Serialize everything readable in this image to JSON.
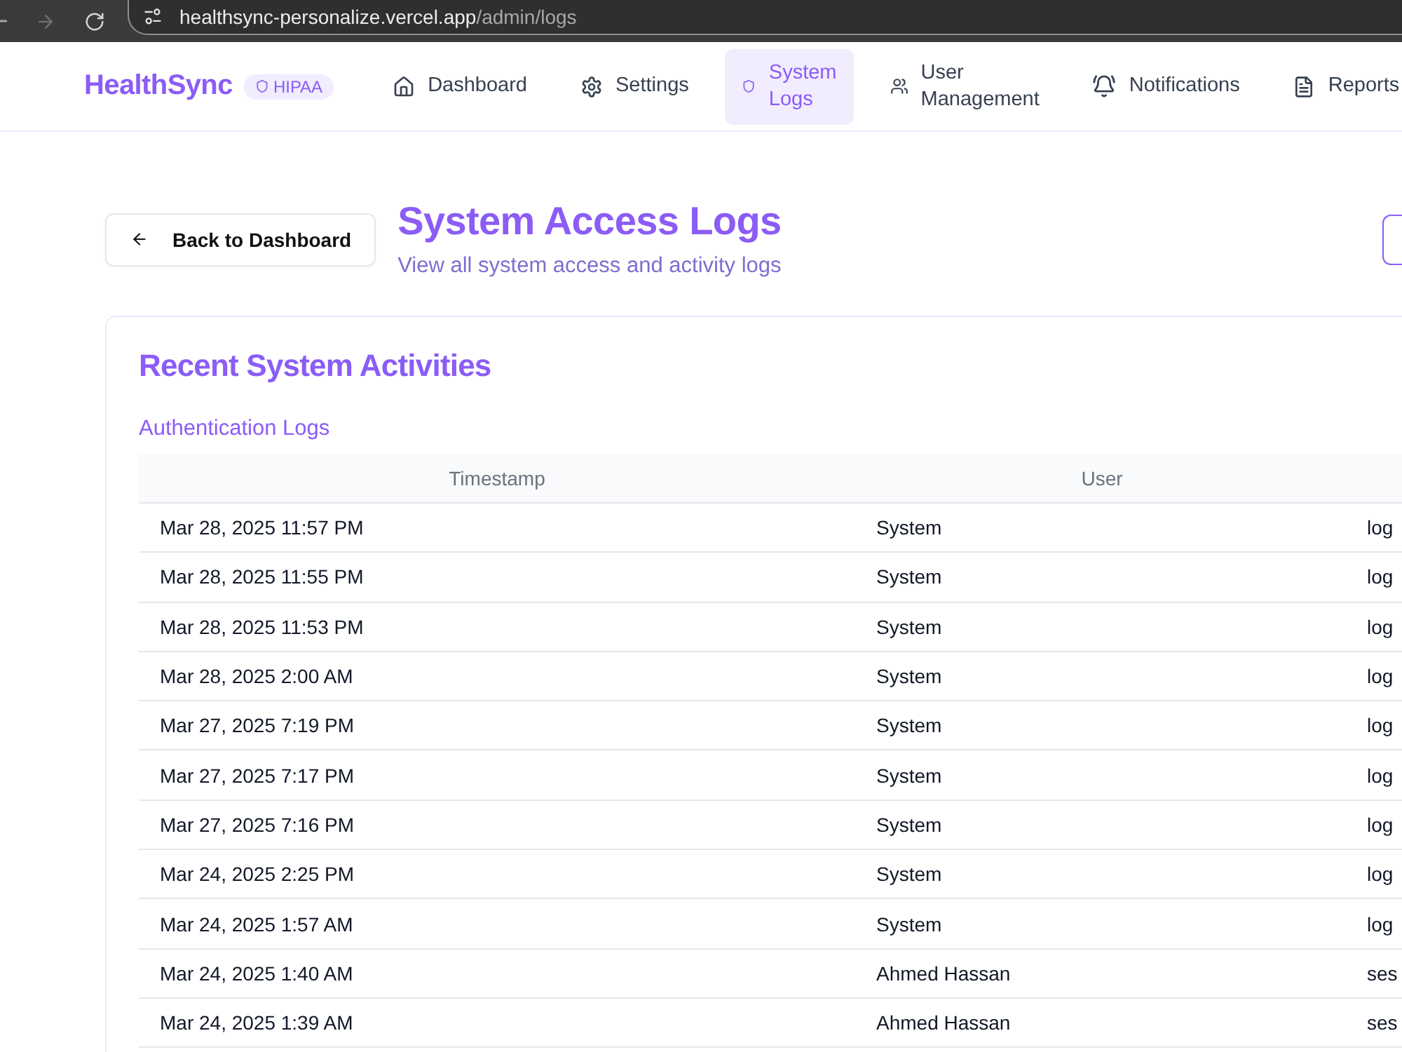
{
  "browser": {
    "url_host": "healthsync-personalize.vercel.app",
    "url_path": "/admin/logs"
  },
  "header": {
    "brand": "HealthSync",
    "badge": "HIPAA",
    "nav": [
      {
        "label": "Dashboard",
        "selected": false
      },
      {
        "label": "Settings",
        "selected": false
      },
      {
        "label": "System Logs",
        "selected": true
      },
      {
        "label": "User Management",
        "selected": false
      },
      {
        "label": "Notifications",
        "selected": false
      },
      {
        "label": "Reports",
        "selected": false
      }
    ]
  },
  "page": {
    "back_button": "Back to Dashboard",
    "title": "System Access Logs",
    "subtitle": "View all system access and activity logs"
  },
  "card": {
    "title": "Recent System Activities",
    "section": "Authentication Logs",
    "table": {
      "columns": [
        "Timestamp",
        "User"
      ],
      "rows": [
        [
          "Mar 28, 2025 11:57 PM",
          "System",
          "log"
        ],
        [
          "Mar 28, 2025 11:55 PM",
          "System",
          "log"
        ],
        [
          "Mar 28, 2025 11:53 PM",
          "System",
          "log"
        ],
        [
          "Mar 28, 2025 2:00 AM",
          "System",
          "log"
        ],
        [
          "Mar 27, 2025 7:19 PM",
          "System",
          "log"
        ],
        [
          "Mar 27, 2025 7:17 PM",
          "System",
          "log"
        ],
        [
          "Mar 27, 2025 7:16 PM",
          "System",
          "log"
        ],
        [
          "Mar 24, 2025 2:25 PM",
          "System",
          "log"
        ],
        [
          "Mar 24, 2025 1:57 AM",
          "System",
          "log"
        ],
        [
          "Mar 24, 2025 1:40 AM",
          "Ahmed Hassan",
          "ses"
        ],
        [
          "Mar 24, 2025 1:39 AM",
          "Ahmed Hassan",
          "ses"
        ]
      ]
    }
  }
}
